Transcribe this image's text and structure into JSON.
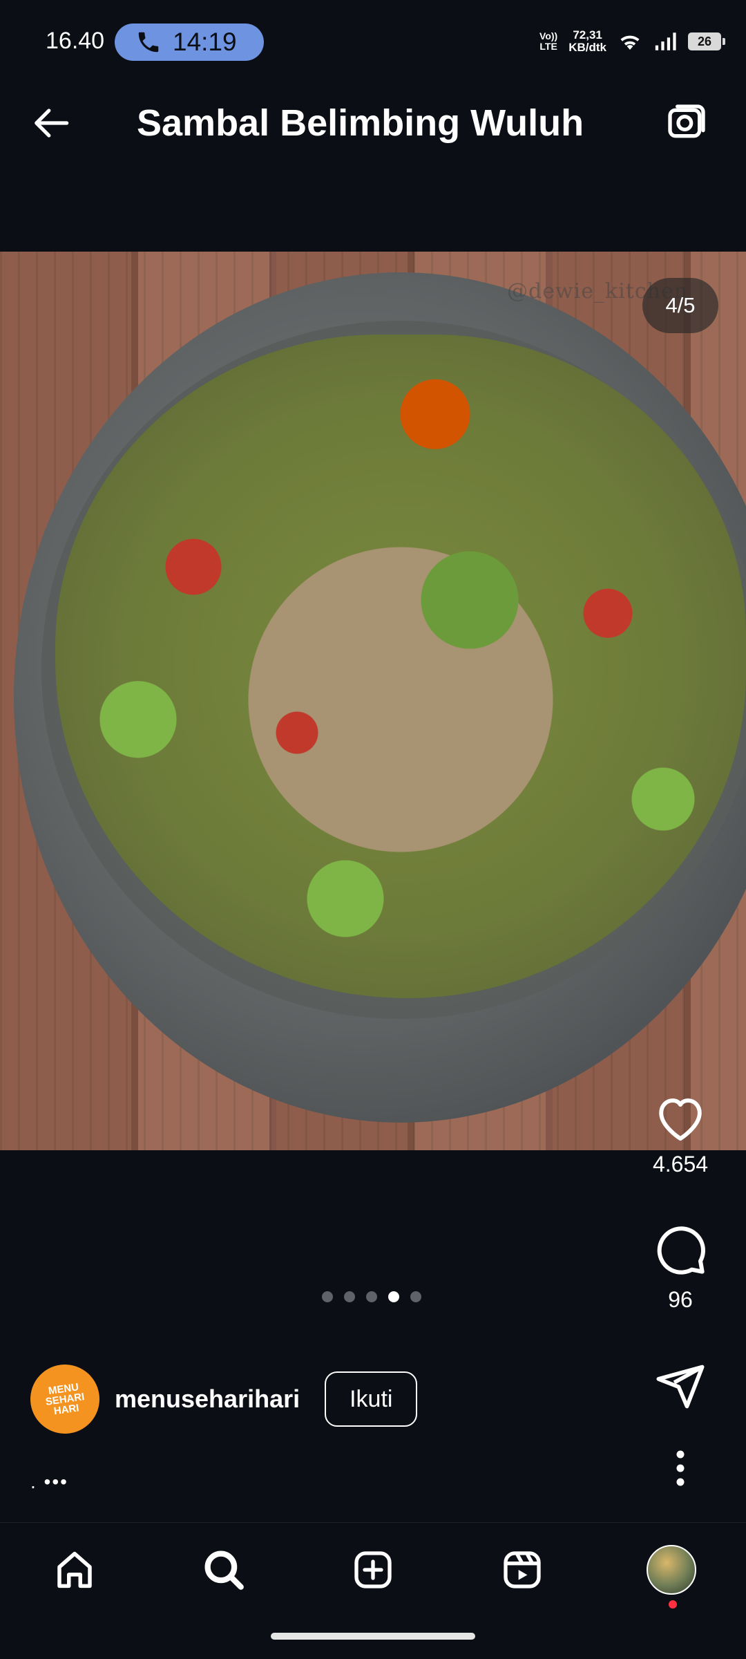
{
  "status_bar": {
    "time": "16.40",
    "call_timer": "14:19",
    "volte_top": "Vo))",
    "volte_bottom": "LTE",
    "speed_value": "72,31",
    "speed_unit": "KB/dtk",
    "battery": "26"
  },
  "header": {
    "title": "Sambal Belimbing Wuluh"
  },
  "post": {
    "watermark": "@dewie_kitchen",
    "counter": "4/5",
    "carousel_dots": 5,
    "active_dot": 4,
    "likes": "4.654",
    "comments": "96"
  },
  "author": {
    "avatar_lines": [
      "MENU",
      "SEHARI",
      "HARI"
    ],
    "username": "menuseharihari",
    "follow_label": "Ikuti"
  },
  "caption": {
    "truncated": ". •••"
  },
  "colors": {
    "call_pill": "#6e93e0",
    "background": "#0b0e14",
    "avatar": "#f4931f",
    "notification": "#ff3040"
  },
  "icons": {
    "back": "arrow-left-icon",
    "camera": "camera-icon",
    "like": "heart-icon",
    "comment": "comment-icon",
    "share": "send-icon",
    "more": "more-vertical-icon",
    "nav": [
      "home-icon",
      "search-icon",
      "add-post-icon",
      "reels-icon",
      "profile-avatar"
    ]
  }
}
